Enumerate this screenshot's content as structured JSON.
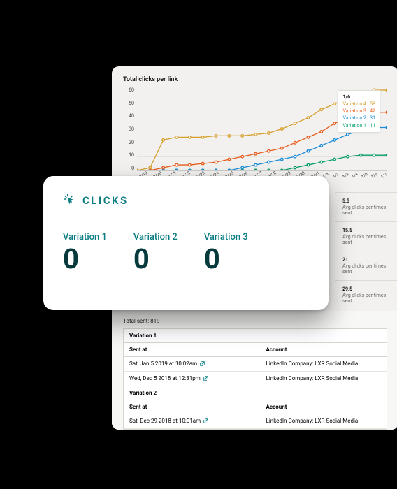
{
  "colors": {
    "teal": "#0a7d82",
    "teal_dark": "#063a3d",
    "series": {
      "v1": "#079e68",
      "v2": "#1a8cd8",
      "v3": "#e85c1c",
      "v4": "#d6a02e"
    }
  },
  "card": {
    "title": "CLICKS",
    "icon_name": "cursor-click-icon",
    "metrics": [
      {
        "label": "Variation 1",
        "value": "0"
      },
      {
        "label": "Variation 2",
        "value": "0"
      },
      {
        "label": "Variation 3",
        "value": "0"
      }
    ]
  },
  "chart_data": {
    "type": "line",
    "title": "Total clicks per link",
    "xlabel": "",
    "ylabel": "",
    "ylim": [
      0,
      60
    ],
    "x_categories": [
      "12/19",
      "12/20",
      "12/21",
      "12/22",
      "12/23",
      "12/24",
      "12/25",
      "12/26",
      "12/27",
      "12/28",
      "12/29",
      "12/30",
      "12/31",
      "1/1",
      "1/2",
      "1/3",
      "1/4",
      "1/5",
      "1/6",
      "1/7"
    ],
    "series": [
      {
        "name": "Variation 1",
        "color": "#079e68",
        "values": [
          0,
          0,
          0,
          0,
          0,
          0,
          0,
          0,
          0,
          0,
          0,
          0,
          2,
          4,
          6,
          8,
          10,
          11,
          11,
          11
        ]
      },
      {
        "name": "Variation 2",
        "color": "#1a8cd8",
        "values": [
          0,
          0,
          0,
          0,
          0,
          0,
          0,
          0,
          2,
          4,
          6,
          8,
          10,
          14,
          18,
          22,
          26,
          29,
          31,
          31
        ]
      },
      {
        "name": "Variation 3",
        "color": "#e85c1c",
        "values": [
          0,
          0,
          2,
          4,
          4,
          5,
          6,
          8,
          10,
          12,
          14,
          16,
          20,
          24,
          28,
          34,
          38,
          40,
          42,
          42
        ]
      },
      {
        "name": "Variation 4",
        "color": "#d6a02e",
        "values": [
          0,
          2,
          22,
          24,
          24,
          24,
          25,
          25,
          25,
          26,
          27,
          30,
          34,
          38,
          44,
          48,
          52,
          56,
          58,
          58
        ]
      }
    ],
    "legend": {
      "title": "1/6",
      "entries": [
        {
          "label": "Variation 4 : 58",
          "color": "#d6a02e"
        },
        {
          "label": "Variation 3 : 42",
          "color": "#e85c1c"
        },
        {
          "label": "Variation 2 : 31",
          "color": "#1a8cd8"
        },
        {
          "label": "Variation 1 : 11",
          "color": "#079e68"
        }
      ]
    }
  },
  "stat_rows": [
    {
      "value": "5.5",
      "label": "Avg clicks per times sent"
    },
    {
      "value": "15.5",
      "label": "Avg clicks per times sent"
    },
    {
      "value": "21",
      "label": "Avg clicks per times sent"
    },
    {
      "value": "29.5",
      "label": "Avg clicks per times sent"
    }
  ],
  "log": {
    "total_sent": "Total sent: 819",
    "col_sent": "Sent at",
    "col_account": "Account",
    "groups": [
      {
        "name": "Variation 1",
        "rows": [
          {
            "sent_at": "Sat, Jan 5 2019 at 10:02am",
            "account": "LinkedIn Company: LXR Social Media"
          },
          {
            "sent_at": "Wed, Dec 5 2018 at 12:31pm",
            "account": "LinkedIn Company: LXR Social Media"
          }
        ]
      },
      {
        "name": "Variation 2",
        "rows": [
          {
            "sent_at": "Sat, Dec 29 2018 at 10:01am",
            "account": "LinkedIn Company: LXR Social Media"
          }
        ]
      }
    ]
  }
}
